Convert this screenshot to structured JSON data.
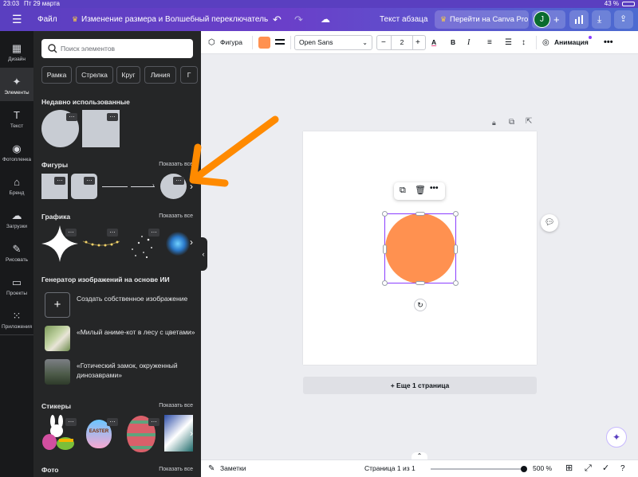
{
  "status": {
    "time": "23:03",
    "date": "Пт 29 марта",
    "battery": "43 %"
  },
  "topbar": {
    "file_label": "Файл",
    "doc_title": "Изменение размера и Волшебный переключатель",
    "text_style": "Текст абзаца",
    "upgrade_label": "Перейти на Canva Pro",
    "avatar_initial": "J"
  },
  "rail": {
    "items": [
      {
        "label": "Дизайн",
        "icon": "layout-icon"
      },
      {
        "label": "Элементы",
        "icon": "shapes-icon"
      },
      {
        "label": "Текст",
        "icon": "text-icon"
      },
      {
        "label": "Фотопленка",
        "icon": "camera-icon"
      },
      {
        "label": "Бренд",
        "icon": "brand-icon"
      },
      {
        "label": "Загрузки",
        "icon": "cloud-upload-icon"
      },
      {
        "label": "Рисовать",
        "icon": "pen-icon"
      },
      {
        "label": "Проекты",
        "icon": "folder-icon"
      },
      {
        "label": "Приложения",
        "icon": "apps-icon"
      }
    ]
  },
  "panel": {
    "search_placeholder": "Поиск элементов",
    "chips": [
      "Рамка",
      "Стрелка",
      "Круг",
      "Линия",
      "Г"
    ],
    "recent_title": "Недавно использованные",
    "shapes_title": "Фигуры",
    "graphics_title": "Графика",
    "show_all": "Показать все",
    "ai_title": "Генератор изображений на основе ИИ",
    "ai_items": [
      "Создать собственное изображение",
      "«Милый аниме-кот в лесу с цветами»",
      "«Готический замок, окруженный динозаврами»"
    ],
    "stickers_title": "Стикеры",
    "sticker_easter": "EASTER",
    "photos_title": "Фото"
  },
  "toolbar": {
    "shape_label": "Фигура",
    "fill_color": "#ff9150",
    "font_name": "Open Sans",
    "font_size": "2",
    "animation_label": "Анимация"
  },
  "canvas": {
    "add_page_label": "+ Еще 1 страница",
    "shape_color": "#ff9150"
  },
  "bottombar": {
    "notes_label": "Заметки",
    "page_indicator": "Страница 1 из 1",
    "zoom": "500 %"
  },
  "accent": {
    "arrow": "#ff8a00",
    "selection": "#8b3dff"
  }
}
